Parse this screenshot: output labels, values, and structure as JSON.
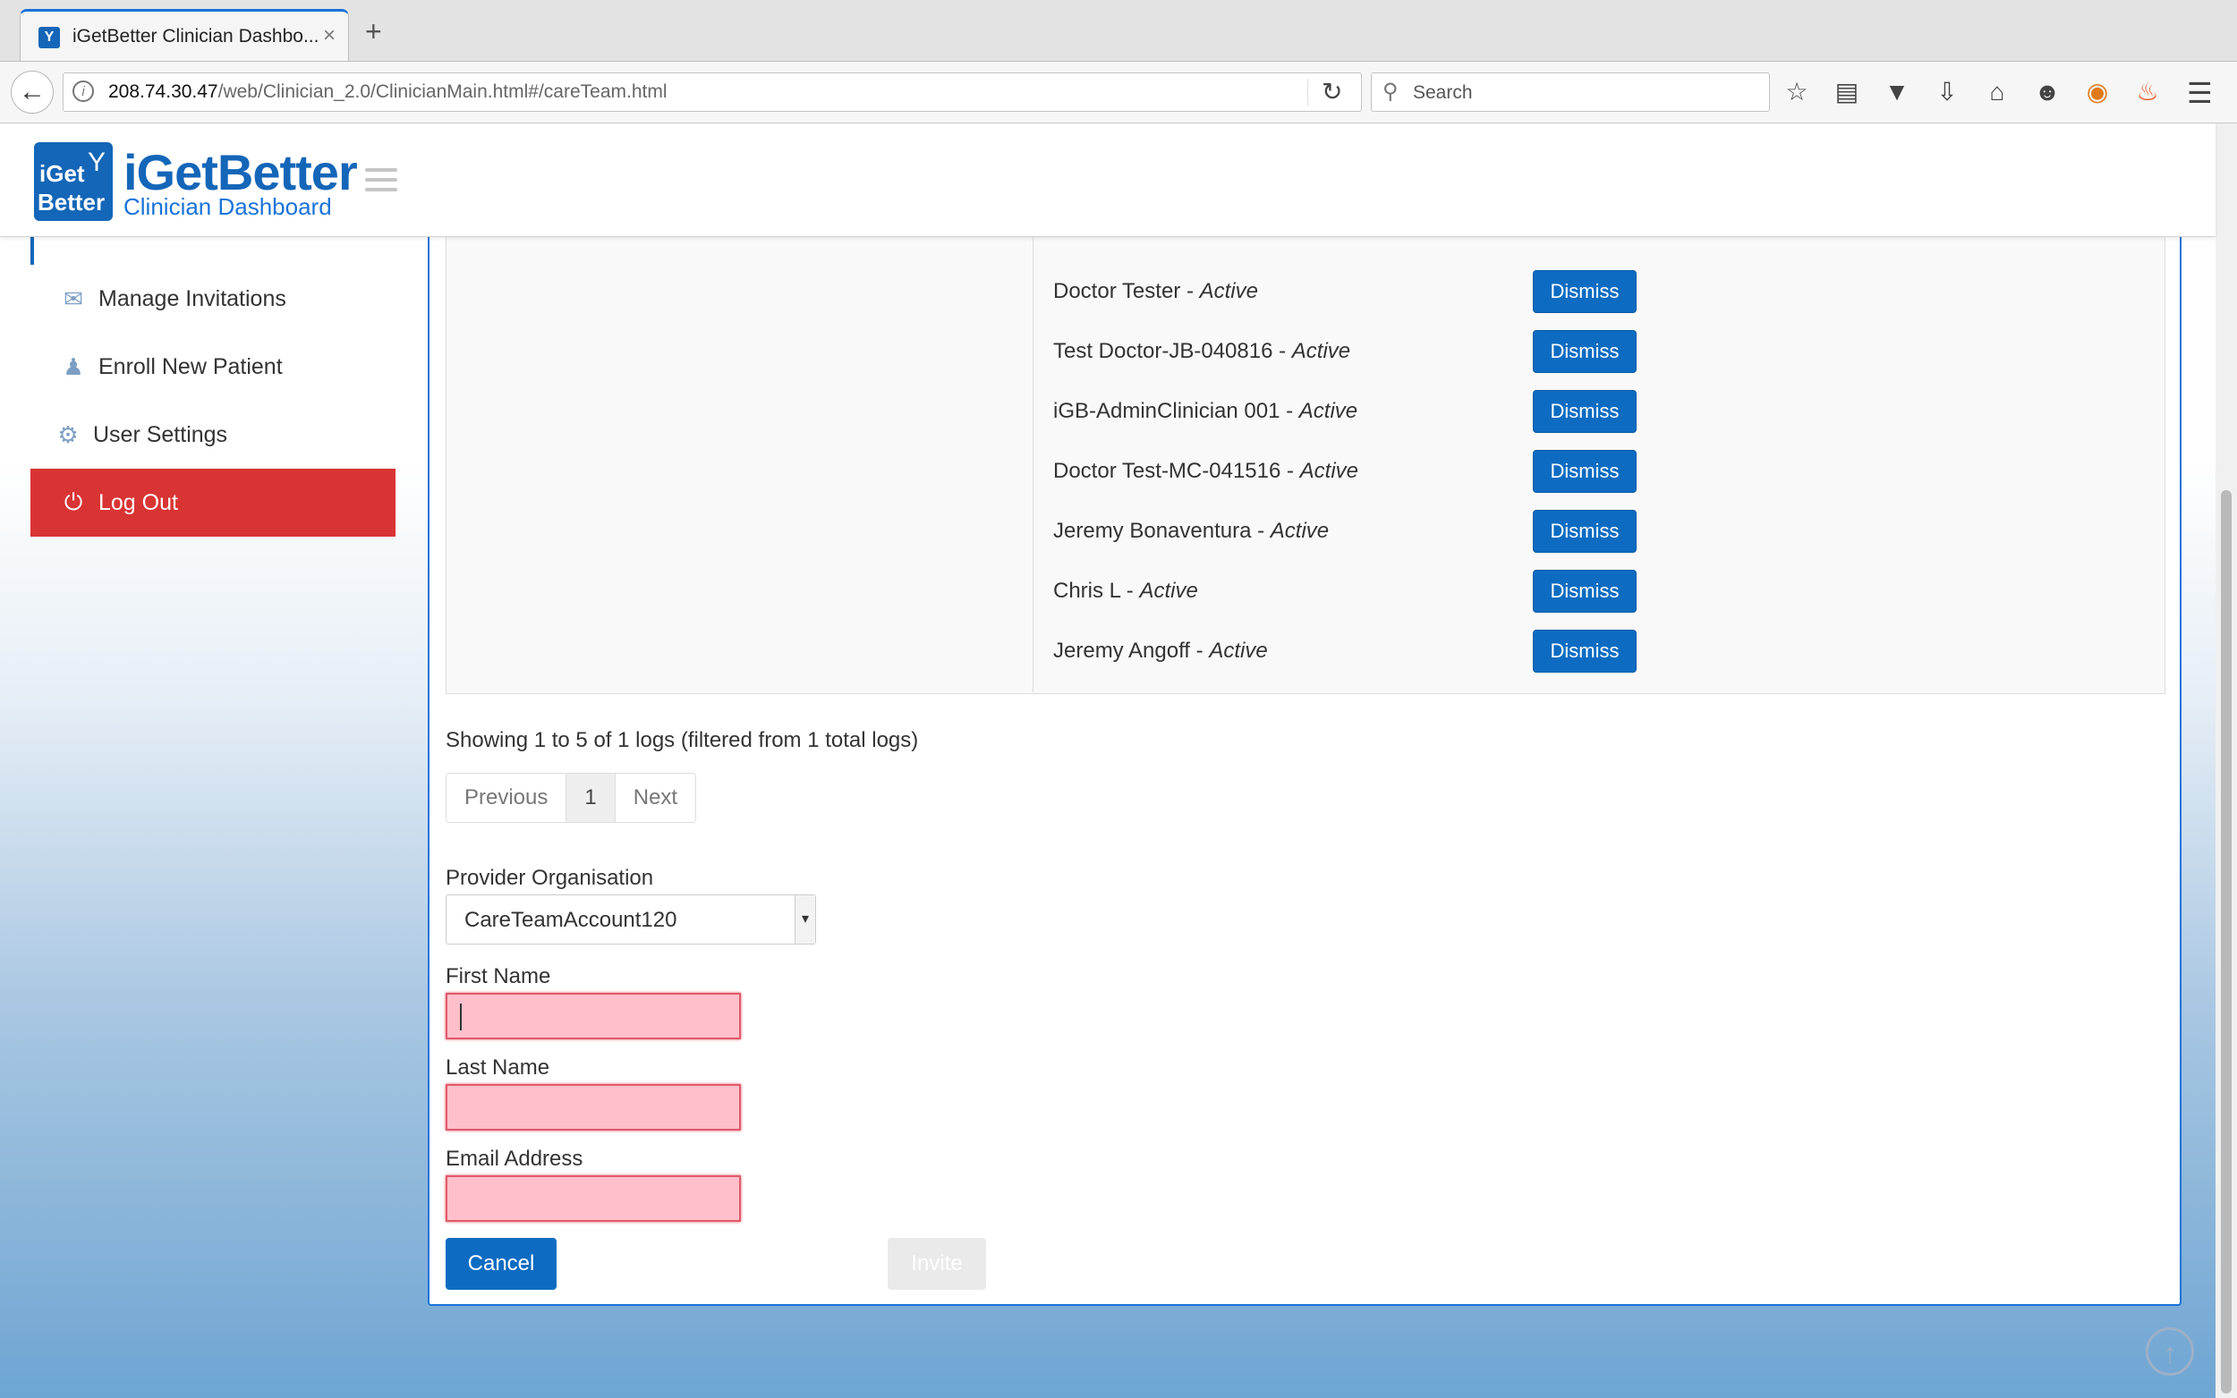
{
  "browser": {
    "tab_title": "iGetBetter Clinician Dashbo...",
    "tab_close": "×",
    "new_tab": "+",
    "url_host": "208.74.30.47",
    "url_path": "/web/Clinician_2.0/ClinicianMain.html#/careTeam.html",
    "search_placeholder": "Search",
    "toolbar_icons": [
      "star-icon",
      "reading-list-icon",
      "pocket-icon",
      "download-icon",
      "home-icon",
      "chat-icon",
      "color-wheel-icon",
      "fire-icon"
    ]
  },
  "header": {
    "logo_line1": "iGet",
    "logo_line2": "Better",
    "brand_name": "iGetBetter",
    "brand_subtitle": "Clinician Dashboard"
  },
  "sidebar": {
    "items": [
      {
        "label": "Manage Invitations",
        "icon": "envelope-icon"
      },
      {
        "label": "Enroll New Patient",
        "icon": "user-plus-icon"
      },
      {
        "label": "User Settings",
        "icon": "gear-icon"
      },
      {
        "label": "Log Out",
        "icon": "power-icon"
      }
    ]
  },
  "care_team": {
    "members": [
      {
        "name": "Doctor Tester",
        "status": "Active"
      },
      {
        "name": "Test Doctor-JB-040816",
        "status": "Active"
      },
      {
        "name": "iGB-AdminClinician 001",
        "status": "Active"
      },
      {
        "name": "Doctor Test-MC-041516",
        "status": "Active"
      },
      {
        "name": "Jeremy Bonaventura",
        "status": "Active"
      },
      {
        "name": "Chris L",
        "status": "Active"
      },
      {
        "name": "Jeremy Angoff",
        "status": "Active"
      }
    ],
    "dismiss_label": "Dismiss",
    "status_separator": " - "
  },
  "table_info": "Showing 1 to 5 of 1 logs (filtered from 1 total logs)",
  "pagination": {
    "previous": "Previous",
    "current": "1",
    "next": "Next"
  },
  "form": {
    "provider_org_label": "Provider Organisation",
    "provider_org_value": "CareTeamAccount120",
    "first_name_label": "First Name",
    "first_name_value": "",
    "last_name_label": "Last Name",
    "last_name_value": "",
    "email_label": "Email Address",
    "email_value": "",
    "cancel_label": "Cancel",
    "invite_label": "Invite",
    "error_color": "#ffc0cb"
  },
  "colors": {
    "brand": "#1466b8",
    "button": "#0d6cc2",
    "logout": "#d93434"
  }
}
